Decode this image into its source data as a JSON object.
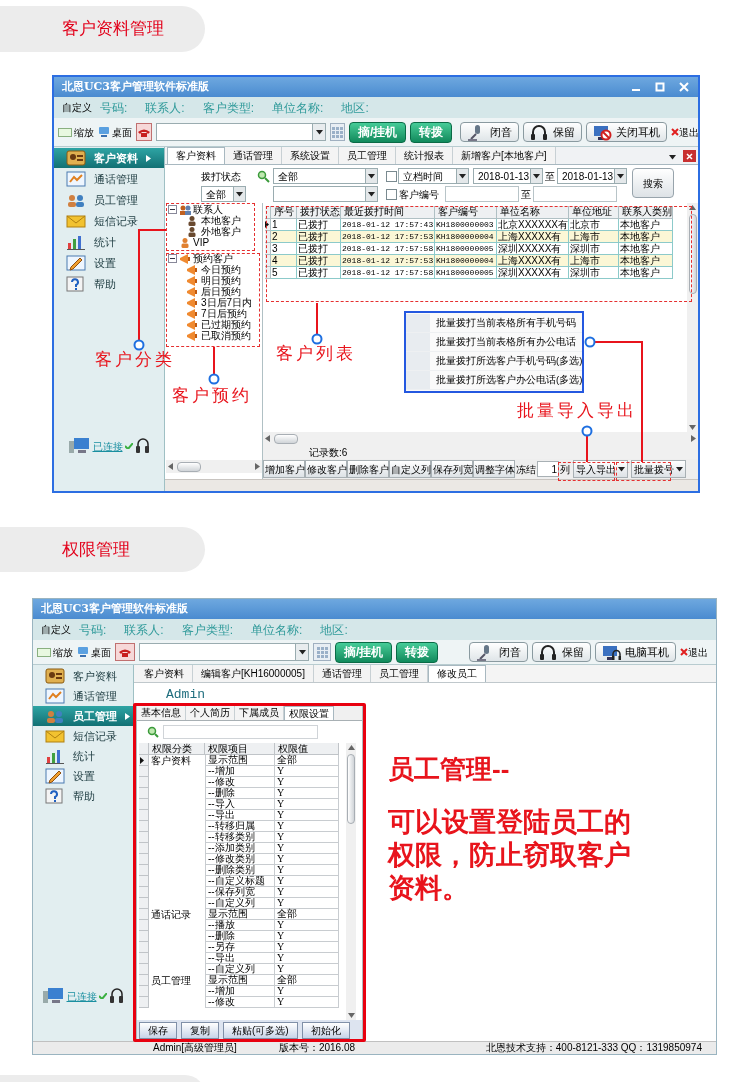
{
  "section_1": {
    "heading": "客户资料管理",
    "app": {
      "title": "北恩UC3客户管理软件标准版",
      "window_controls": true,
      "fields": [
        {
          "kind": "button",
          "label": "自定义"
        },
        {
          "kind": "label",
          "label": "号码:"
        },
        {
          "kind": "label",
          "label": "联系人:"
        },
        {
          "kind": "label",
          "label": "客户类型:"
        },
        {
          "kind": "label",
          "label": "单位名称:"
        },
        {
          "kind": "label",
          "label": "地区:"
        }
      ],
      "toolbar": {
        "zoom": "缩放",
        "desktop": "桌面",
        "call_buttons": [
          "摘/挂机",
          "转拨"
        ],
        "actions": [
          {
            "kind": "mute",
            "label": "闭音"
          },
          {
            "kind": "hold",
            "label": "保留"
          },
          {
            "kind": "headset_off",
            "label": "关闭耳机"
          }
        ],
        "exit": "退出"
      },
      "sidebar": {
        "items": [
          {
            "label": "客户资料",
            "selected": true
          },
          {
            "label": "通话管理",
            "selected": false
          },
          {
            "label": "员工管理",
            "selected": false
          },
          {
            "label": "短信记录",
            "selected": false
          },
          {
            "label": "统计",
            "selected": false
          },
          {
            "label": "设置",
            "selected": false
          },
          {
            "label": "帮助",
            "selected": false
          }
        ],
        "connection": "已连接"
      },
      "tabs": [
        {
          "label": "客户资料",
          "selected": true
        },
        {
          "label": "通话管理",
          "selected": false
        },
        {
          "label": "系统设置",
          "selected": false
        },
        {
          "label": "员工管理",
          "selected": false
        },
        {
          "label": "统计报表",
          "selected": false
        },
        {
          "label": "新增客户[本地客户]",
          "selected": false
        }
      ],
      "filters": {
        "status_label": "拨打状态",
        "status_value": "全部",
        "group_value": "全部",
        "date_checked": false,
        "date_field": "立档时间",
        "date_from": "2018-01-13",
        "date_to": "2018-01-13",
        "to_1": "至",
        "code_checked": false,
        "code_label": "客户编号",
        "to_2": "至",
        "search_button": "搜索"
      },
      "tree": [
        {
          "kind": "contacts",
          "label": "联系人",
          "expanded": true,
          "children": [
            {
              "label": "本地客户"
            },
            {
              "label": "外地客户"
            }
          ]
        },
        {
          "kind": "vip",
          "label": "VIP"
        },
        {
          "kind": "reservations",
          "label": "预约客户",
          "expanded": true,
          "children": [
            {
              "label": "今日预约"
            },
            {
              "label": "明日预约"
            },
            {
              "label": "后日预约"
            },
            {
              "label": "3日后7日内"
            },
            {
              "label": "7日后预约"
            },
            {
              "label": "已过期预约"
            },
            {
              "label": "已取消预约"
            }
          ]
        }
      ],
      "table": {
        "columns": [
          "序号",
          "拨打状态",
          "最近拨打时间",
          "客户编号",
          "单位名称",
          "单位地址",
          "联系人类别"
        ],
        "rows": [
          {
            "current": true,
            "cells": [
              "1",
              "已拨打",
              "2018-01-12 17:57:43",
              "KH1800000003",
              "北京XXXXXX有",
              "北京市",
              "本地客户"
            ]
          },
          {
            "current": false,
            "cells": [
              "2",
              "已拨打",
              "2018-01-12 17:57:53",
              "KH1800000004",
              "上海XXXXX有",
              "上海市",
              "本地客户"
            ]
          },
          {
            "current": false,
            "cells": [
              "3",
              "已拨打",
              "2018-01-12 17:57:58",
              "KH1800000005",
              "深圳XXXXX有",
              "深圳市",
              "本地客户"
            ]
          },
          {
            "current": false,
            "cells": [
              "4",
              "已拨打",
              "2018-01-12 17:57:53",
              "KH1800000004",
              "上海XXXXX有",
              "上海市",
              "本地客户"
            ]
          },
          {
            "current": false,
            "cells": [
              "5",
              "已拨打",
              "2018-01-12 17:57:58",
              "KH1800000005",
              "深圳XXXXX有",
              "深圳市",
              "本地客户"
            ]
          }
        ]
      },
      "popup_menu": [
        "批量拨打当前表格所有手机号码",
        "批量拨打当前表格所有办公电话",
        "批量拨打所选客户手机号码(多选)",
        "批量拨打所选客户办公电话(多选)"
      ],
      "record_count": "记录数:6",
      "bottom_buttons": [
        "增加客户",
        "修改客户",
        "删除客户",
        "自定义列",
        "保存列宽",
        "调整字体"
      ],
      "freeze": {
        "label": "冻结",
        "value": "1",
        "unit": "列"
      },
      "dropdown_buttons": [
        "导入导出",
        "批量拨号"
      ],
      "annotations": [
        "客户分类",
        "客户预约",
        "客户列表",
        "批量导入导出"
      ]
    }
  },
  "section_2": {
    "heading": "权限管理",
    "app": {
      "title": "北恩UC3客户管理软件标准版",
      "fields": [
        {
          "kind": "button",
          "label": "自定义"
        },
        {
          "kind": "label",
          "label": "号码:"
        },
        {
          "kind": "label",
          "label": "联系人:"
        },
        {
          "kind": "label",
          "label": "客户类型:"
        },
        {
          "kind": "label",
          "label": "单位名称:"
        },
        {
          "kind": "label",
          "label": "地区:"
        }
      ],
      "toolbar": {
        "zoom": "缩放",
        "desktop": "桌面",
        "call_buttons": [
          "摘/挂机",
          "转拨"
        ],
        "actions": [
          {
            "kind": "mute",
            "label": "闭音"
          },
          {
            "kind": "hold",
            "label": "保留"
          },
          {
            "kind": "headset",
            "label": "电脑耳机"
          }
        ],
        "exit": "退出"
      },
      "sidebar": {
        "items": [
          {
            "label": "客户资料",
            "selected": false
          },
          {
            "label": "通话管理",
            "selected": false
          },
          {
            "label": "员工管理",
            "selected": true
          },
          {
            "label": "短信记录",
            "selected": false
          },
          {
            "label": "统计",
            "selected": false
          },
          {
            "label": "设置",
            "selected": false
          },
          {
            "label": "帮助",
            "selected": false
          }
        ],
        "connection": "已连接"
      },
      "tabs": [
        {
          "label": "客户资料",
          "selected": false
        },
        {
          "label": "编辑客户[KH16000005]",
          "selected": false
        },
        {
          "label": "通话管理",
          "selected": false
        },
        {
          "label": "员工管理",
          "selected": false
        },
        {
          "label": "修改员工",
          "selected": true
        }
      ],
      "user_name": "Admin",
      "subtabs": [
        {
          "label": "基本信息",
          "selected": false
        },
        {
          "label": "个人简历",
          "selected": false
        },
        {
          "label": "下属成员",
          "selected": false
        },
        {
          "label": "权限设置",
          "selected": true
        }
      ],
      "permissions": {
        "columns": [
          "权限分类",
          "权限项目",
          "权限值"
        ],
        "groups": [
          {
            "category": "客户资料",
            "items": [
              {
                "item": "显示范围",
                "value": "全部",
                "current": true
              },
              {
                "item": "--增加",
                "value": "Y",
                "current": false
              },
              {
                "item": "--修改",
                "value": "Y",
                "current": false
              },
              {
                "item": "--删除",
                "value": "Y",
                "current": false
              },
              {
                "item": "--导入",
                "value": "Y",
                "current": false
              },
              {
                "item": "--导出",
                "value": "Y",
                "current": false
              },
              {
                "item": "--转移归属",
                "value": "Y",
                "current": false
              },
              {
                "item": "--转移类别",
                "value": "Y",
                "current": false
              },
              {
                "item": "--添加类别",
                "value": "Y",
                "current": false
              },
              {
                "item": "--修改类别",
                "value": "Y",
                "current": false
              },
              {
                "item": "--删除类别",
                "value": "Y",
                "current": false
              },
              {
                "item": "--自定义标题",
                "value": "Y",
                "current": false
              },
              {
                "item": "--保存列宽",
                "value": "Y",
                "current": false
              },
              {
                "item": "--自定义列",
                "value": "Y",
                "current": false
              }
            ]
          },
          {
            "category": "通话记录",
            "items": [
              {
                "item": "显示范围",
                "value": "全部",
                "current": false
              },
              {
                "item": "--播放",
                "value": "Y",
                "current": false
              },
              {
                "item": "--删除",
                "value": "Y",
                "current": false
              },
              {
                "item": "--另存",
                "value": "Y",
                "current": false
              },
              {
                "item": "--导出",
                "value": "Y",
                "current": false
              },
              {
                "item": "--自定义列",
                "value": "Y",
                "current": false
              }
            ]
          },
          {
            "category": "员工管理",
            "items": [
              {
                "item": "显示范围",
                "value": "全部",
                "current": false
              },
              {
                "item": "--增加",
                "value": "Y",
                "current": false
              },
              {
                "item": "--修改",
                "value": "Y",
                "current": false
              }
            ]
          }
        ]
      },
      "panel_buttons": [
        "保存",
        "复制",
        "粘贴(可多选)",
        "初始化"
      ],
      "status_bar": [
        "Admin[高级管理员]",
        "版本号：2016.08",
        "北恩技术支持：400-8121-333 QQ：1319850974"
      ],
      "callout": {
        "title": "员工管理--",
        "body": "可以设置登陆员工的权限，防止窃取客户资料。"
      }
    }
  }
}
